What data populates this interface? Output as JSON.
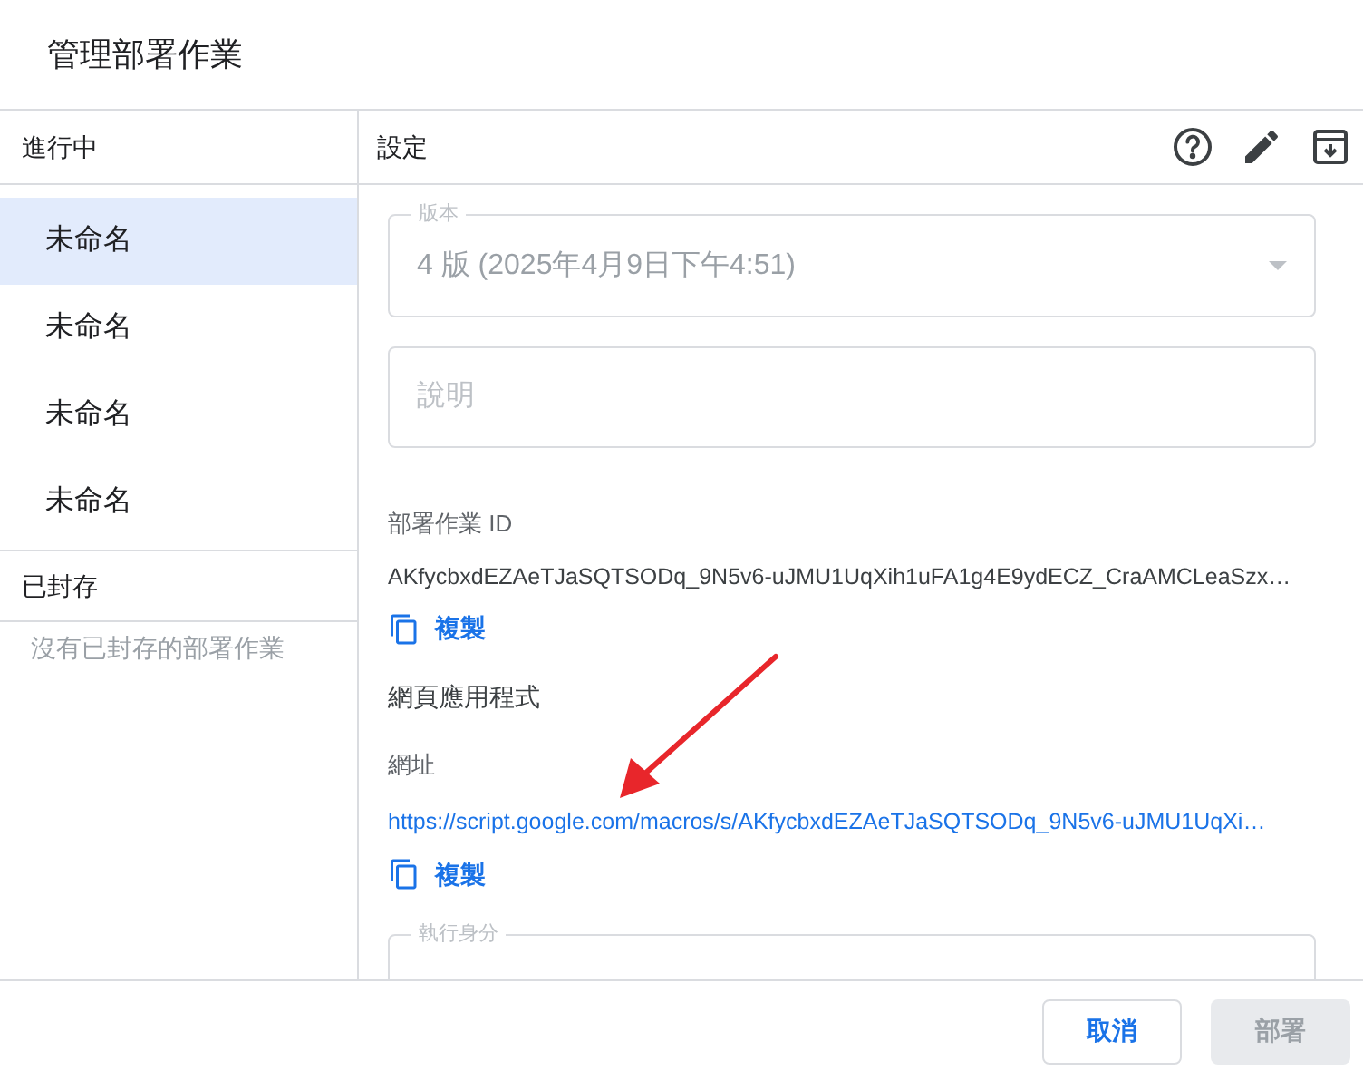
{
  "dialog": {
    "title": "管理部署作業"
  },
  "sidebar": {
    "active_heading": "進行中",
    "items": [
      {
        "label": "未命名",
        "selected": true
      },
      {
        "label": "未命名",
        "selected": false
      },
      {
        "label": "未命名",
        "selected": false
      },
      {
        "label": "未命名",
        "selected": false
      }
    ],
    "archived_heading": "已封存",
    "archived_empty": "沒有已封存的部署作業"
  },
  "settings": {
    "heading": "設定",
    "version": {
      "label": "版本",
      "value": "4 版 (2025年4月9日下午4:51)",
      "disabled": true
    },
    "description": {
      "placeholder": "說明"
    },
    "deployment_id": {
      "label": "部署作業 ID",
      "value": "AKfycbxdEZAeTJaSQTSODq_9N5v6-uJMU1UqXih1uFA1g4E9ydECZ_CraAMCLeaSzx…",
      "copy": "複製"
    },
    "web_app": {
      "heading": "網頁應用程式",
      "url_label": "網址",
      "url": "https://script.google.com/macros/s/AKfycbxdEZAeTJaSQTSODq_9N5v6-uJMU1UqXi…",
      "copy": "複製"
    },
    "execute_as": {
      "label": "執行身分"
    }
  },
  "footer": {
    "buttons": [
      {
        "label": "取消",
        "disabled": false
      },
      {
        "label": "部署",
        "disabled": true
      }
    ]
  }
}
